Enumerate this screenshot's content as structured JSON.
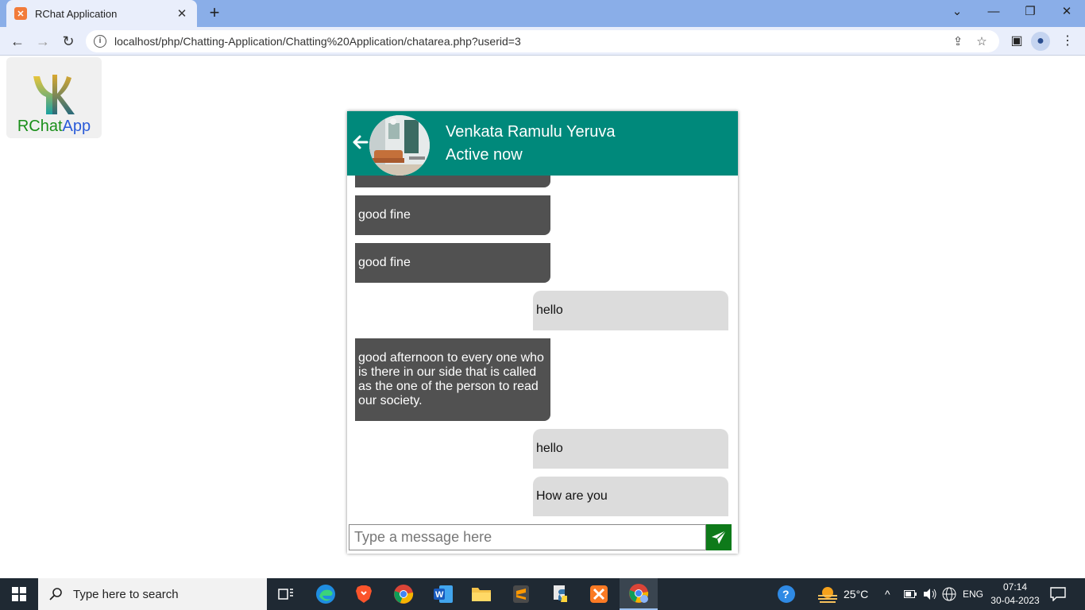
{
  "browser": {
    "tab_title": "RChat Application",
    "tab_favicon": "xampp-icon",
    "url": "localhost/php/Chatting-Application/Chatting%20Application/chatarea.php?userid=3"
  },
  "logo": {
    "text_r": "RChat",
    "text_app": "App"
  },
  "chat": {
    "contact_name": "Venkata Ramulu Yeruva",
    "status": "Active now",
    "messages": [
      {
        "direction": "incoming",
        "text": ""
      },
      {
        "direction": "incoming",
        "text": "good fine"
      },
      {
        "direction": "incoming",
        "text": "good fine"
      },
      {
        "direction": "outgoing",
        "text": "hello"
      },
      {
        "direction": "incoming",
        "text": "good afternoon to every one who is there in our side that is called as the one of the person to read our society."
      },
      {
        "direction": "outgoing",
        "text": "hello"
      },
      {
        "direction": "outgoing",
        "text": "How are you"
      }
    ],
    "input_placeholder": "Type a message here",
    "colors": {
      "header": "#00897b",
      "incoming_bubble": "#515151",
      "outgoing_bubble": "#dcdcdc",
      "send_button": "#0e7a1a"
    }
  },
  "taskbar": {
    "search_placeholder": "Type here to search",
    "weather": "25°C",
    "language": "ENG",
    "time": "07:14",
    "date": "30-04-2023"
  }
}
